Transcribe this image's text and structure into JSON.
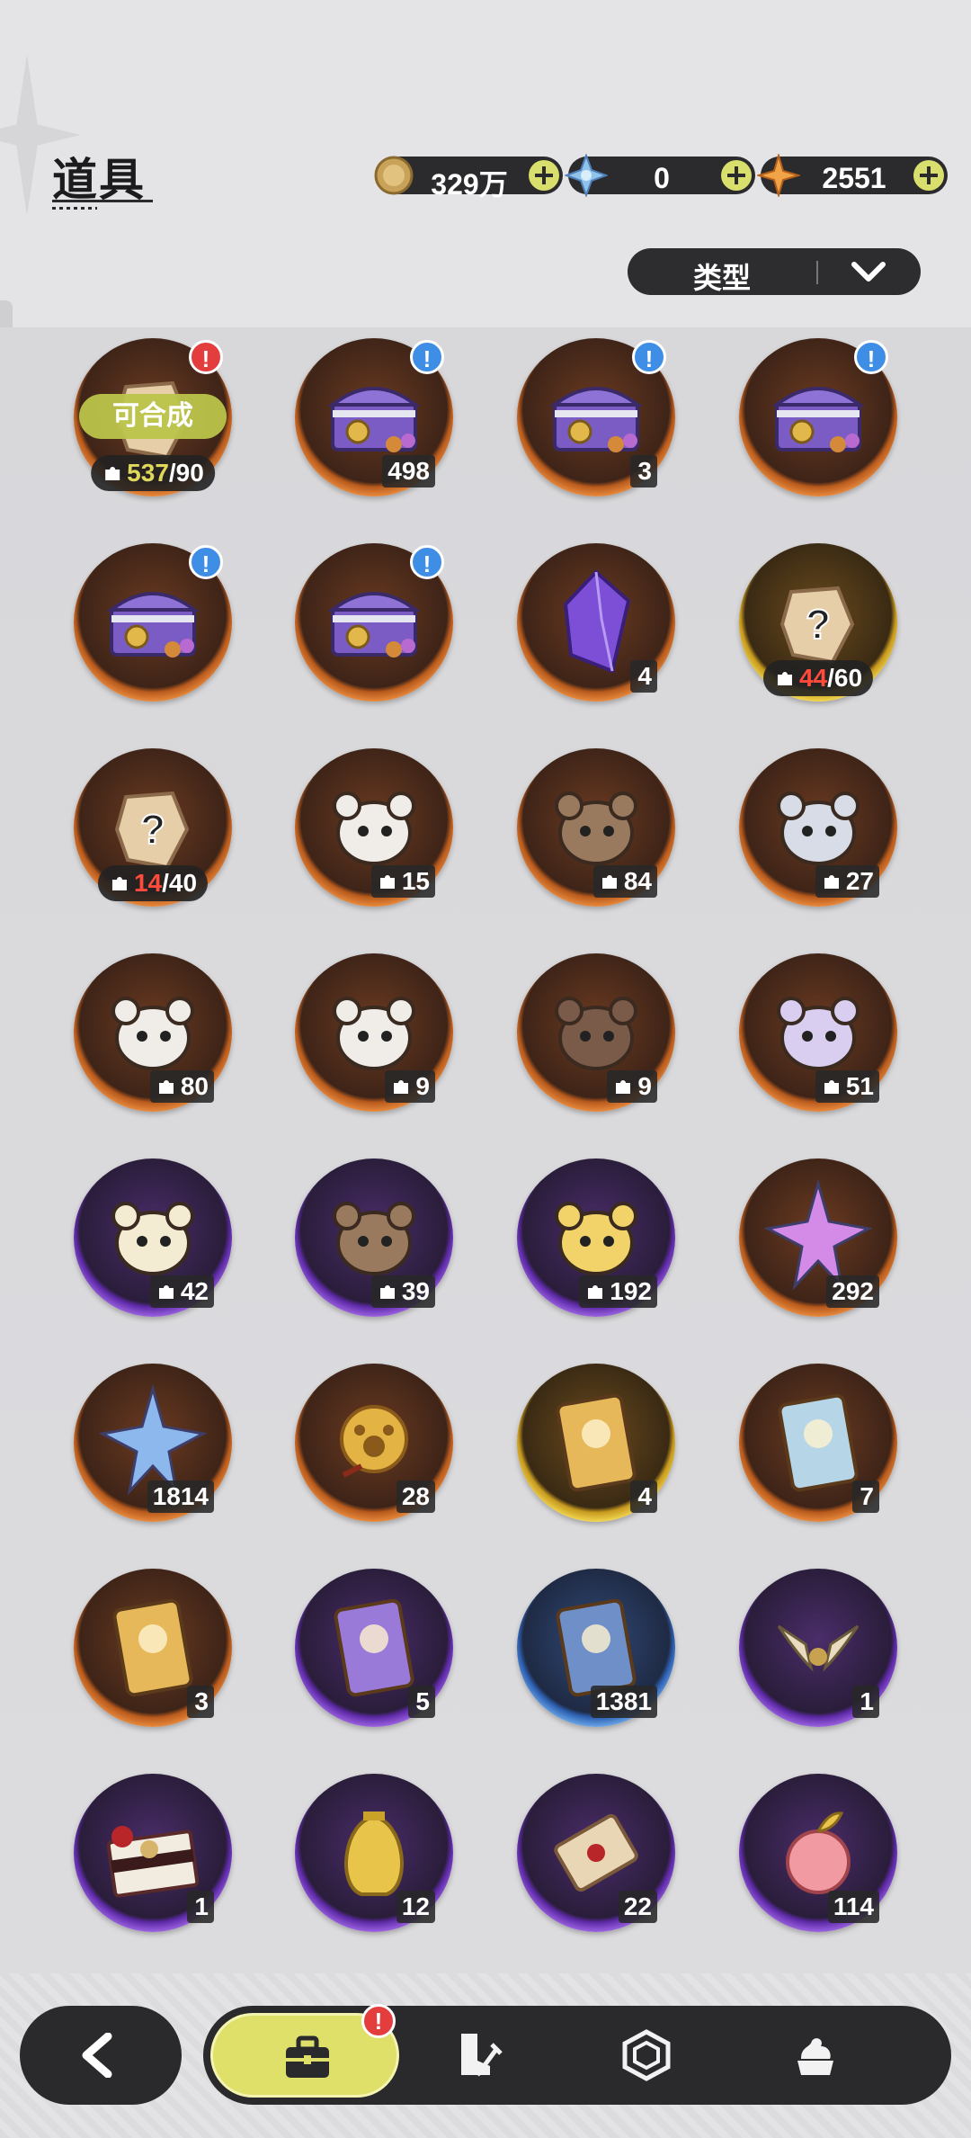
{
  "header": {
    "title": "道具",
    "currencies": [
      {
        "name": "gold-coin",
        "value": "329万"
      },
      {
        "name": "crystal",
        "value": "0"
      },
      {
        "name": "star-gem",
        "value": "2551"
      }
    ],
    "filter_label": "类型"
  },
  "items": [
    {
      "kind": "piece",
      "have": "537",
      "need": "/90",
      "have_state": "ok",
      "synth": "可合成",
      "badge": "!",
      "badge_color": "red",
      "ring": "orange",
      "icon": "fragment-icon"
    },
    {
      "kind": "count",
      "count": "498",
      "badge": "!",
      "badge_color": "blue",
      "ring": "orange",
      "icon": "treasure-chest-icon"
    },
    {
      "kind": "count",
      "count": "3",
      "badge": "!",
      "badge_color": "blue",
      "ring": "orange",
      "icon": "treasure-chest-icon"
    },
    {
      "kind": "count",
      "count": "",
      "badge": "!",
      "badge_color": "blue",
      "ring": "orange",
      "icon": "treasure-chest-icon"
    },
    {
      "kind": "count",
      "count": "",
      "badge": "!",
      "badge_color": "blue",
      "ring": "orange",
      "icon": "treasure-chest-icon"
    },
    {
      "kind": "count",
      "count": "",
      "badge": "!",
      "badge_color": "blue",
      "ring": "orange",
      "icon": "treasure-chest-icon"
    },
    {
      "kind": "count",
      "count": "4",
      "ring": "orange",
      "icon": "purple-crystal-icon"
    },
    {
      "kind": "piece",
      "have": "44",
      "need": "/60",
      "have_state": "low",
      "ring": "gold",
      "icon": "mystery-fragment-icon"
    },
    {
      "kind": "piece",
      "have": "14",
      "need": "/40",
      "have_state": "low",
      "ring": "orange",
      "icon": "mystery-fragment-icon"
    },
    {
      "kind": "pcount",
      "count": "15",
      "ring": "orange",
      "icon": "cat-doll-icon"
    },
    {
      "kind": "pcount",
      "count": "84",
      "ring": "orange",
      "icon": "bear-doll-icon"
    },
    {
      "kind": "pcount",
      "count": "27",
      "ring": "orange",
      "icon": "knight-doll-icon"
    },
    {
      "kind": "pcount",
      "count": "80",
      "ring": "orange",
      "icon": "white-cat-doll-icon"
    },
    {
      "kind": "pcount",
      "count": "9",
      "ring": "orange",
      "icon": "white-tiger-doll-icon"
    },
    {
      "kind": "pcount",
      "count": "9",
      "ring": "orange",
      "icon": "brown-bear-doll-icon"
    },
    {
      "kind": "pcount",
      "count": "51",
      "ring": "orange",
      "icon": "purple-fox-doll-icon"
    },
    {
      "kind": "pcount",
      "count": "42",
      "ring": "purple",
      "icon": "green-doll-icon"
    },
    {
      "kind": "pcount",
      "count": "39",
      "ring": "purple",
      "icon": "red-eye-bear-doll-icon"
    },
    {
      "kind": "pcount",
      "count": "192",
      "ring": "purple",
      "icon": "yellow-doll-icon"
    },
    {
      "kind": "count",
      "count": "292",
      "ring": "orange",
      "icon": "pink-star-crystal-icon"
    },
    {
      "kind": "count",
      "count": "1814",
      "ring": "orange",
      "icon": "blue-star-crystal-icon"
    },
    {
      "kind": "count",
      "count": "28",
      "ring": "orange",
      "icon": "paw-medal-icon"
    },
    {
      "kind": "count",
      "count": "4",
      "ring": "gold",
      "icon": "gold-card-icon"
    },
    {
      "kind": "count",
      "count": "7",
      "ring": "orange",
      "icon": "rainbow-card-icon"
    },
    {
      "kind": "count",
      "count": "3",
      "ring": "orange",
      "icon": "gold-card-icon"
    },
    {
      "kind": "count",
      "count": "5",
      "ring": "purple",
      "icon": "purple-card-icon"
    },
    {
      "kind": "count",
      "count": "1381",
      "ring": "blue",
      "icon": "blue-card-icon"
    },
    {
      "kind": "count",
      "count": "1",
      "ring": "purple",
      "icon": "horn-ornament-icon"
    },
    {
      "kind": "count",
      "count": "1",
      "ring": "purple",
      "icon": "gift-box-icon"
    },
    {
      "kind": "count",
      "count": "12",
      "ring": "purple",
      "icon": "gold-pouch-icon"
    },
    {
      "kind": "count",
      "count": "22",
      "ring": "purple",
      "icon": "scroll-icon"
    },
    {
      "kind": "count",
      "count": "114",
      "ring": "purple",
      "icon": "peach-icon"
    }
  ],
  "nav": {
    "items": [
      "bag-icon",
      "boot-sword-icon",
      "gem-icon",
      "dessert-icon"
    ],
    "badge": "!"
  },
  "colors": {
    "ring_orange": "#d9762e",
    "ring_purple": "#8a4fd1",
    "ring_gold": "#e0c33a",
    "ring_blue": "#4d8ad6",
    "accent": "#dfe06a"
  }
}
